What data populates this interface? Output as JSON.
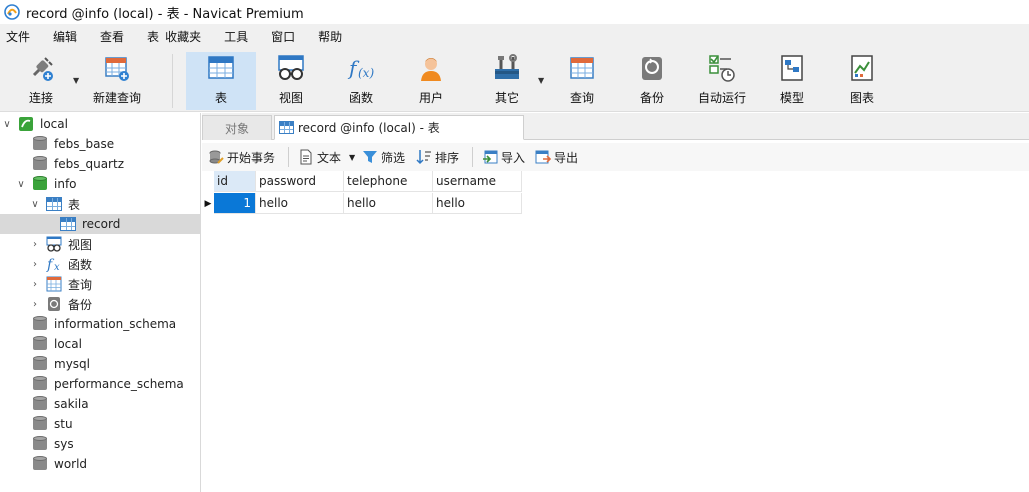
{
  "window": {
    "title": "record @info (local) - 表 - Navicat Premium"
  },
  "menu": [
    "文件",
    "编辑",
    "查看",
    "表",
    "收藏夹",
    "工具",
    "窗口",
    "帮助"
  ],
  "toolbar": {
    "connect": "连接",
    "new_query": "新建查询",
    "table": "表",
    "view": "视图",
    "function": "函数",
    "user": "用户",
    "other": "其它",
    "query": "查询",
    "backup": "备份",
    "auto_run": "自动运行",
    "model": "模型",
    "chart": "图表"
  },
  "tree": {
    "root": "local",
    "databases_top": [
      "febs_base",
      "febs_quartz"
    ],
    "open_db": "info",
    "tables_folder": "表",
    "selected_table": "record",
    "subfolders": [
      "视图",
      "函数",
      "查询",
      "备份"
    ],
    "databases_bottom": [
      "information_schema",
      "local",
      "mysql",
      "performance_schema",
      "sakila",
      "stu",
      "sys",
      "world"
    ]
  },
  "tabs": {
    "objects": "对象",
    "current": "record @info (local) - 表"
  },
  "subtoolbar": {
    "begin_tx": "开始事务",
    "text": "文本",
    "filter": "筛选",
    "sort": "排序",
    "import": "导入",
    "export": "导出"
  },
  "grid": {
    "columns": [
      "id",
      "password",
      "telephone",
      "username"
    ],
    "rows": [
      {
        "id": "1",
        "password": "hello",
        "telephone": "hello",
        "username": "hello"
      }
    ]
  }
}
